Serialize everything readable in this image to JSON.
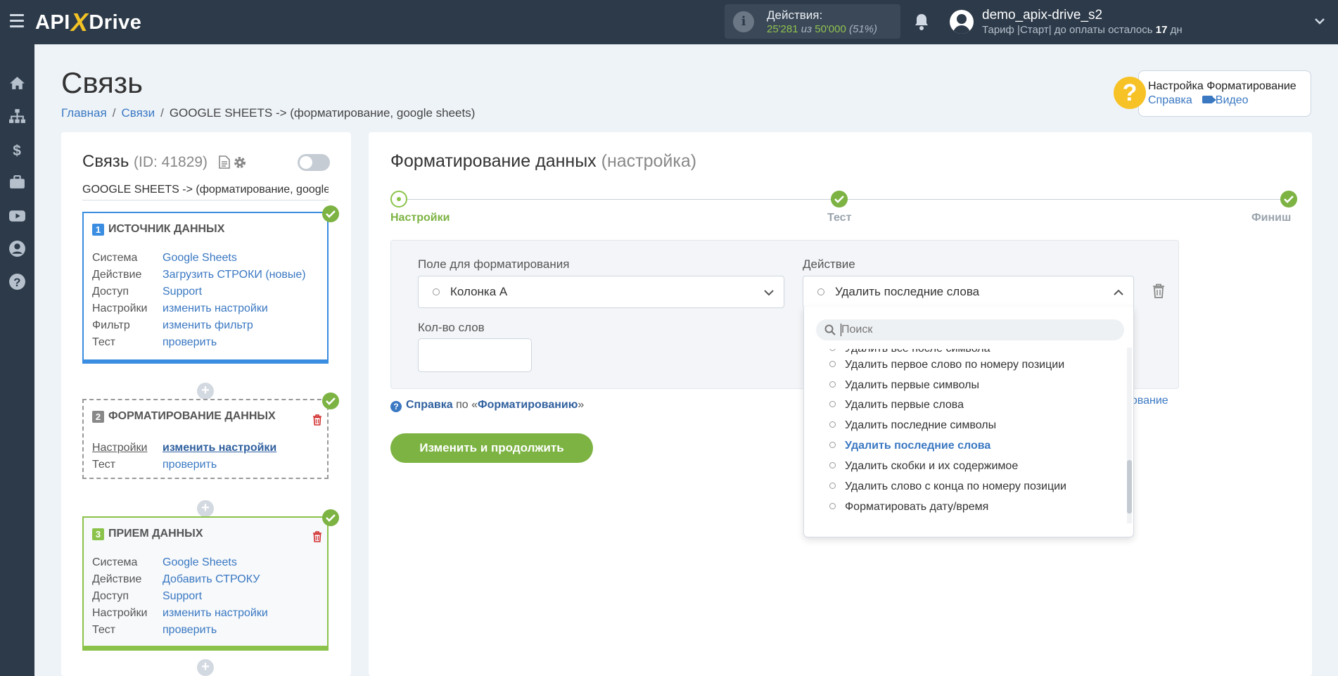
{
  "topbar": {
    "logo_left": "API",
    "logo_x": "X",
    "logo_right": "Drive",
    "actions_label": "Действия:",
    "actions_used": "25'281",
    "actions_of": "из",
    "actions_total": "50'000",
    "actions_percent": "(51%)",
    "user_name": "demo_apix-drive_s2",
    "plan_text": "Тариф |Старт| до оплаты осталось",
    "plan_days": "17",
    "plan_days_unit": "дн"
  },
  "page": {
    "title": "Связь",
    "breadcrumb": [
      "Главная",
      "Связи",
      "GOOGLE SHEETS -> (форматирование, google sheets)"
    ]
  },
  "help": {
    "title": "Настройка Форматирование",
    "link_help": "Справка",
    "link_video": "Видео"
  },
  "connection": {
    "title": "Связь",
    "id_text": "(ID: 41829)",
    "name": "GOOGLE SHEETS -> (форматирование, google sheets)",
    "enabled": false
  },
  "steps": {
    "source": {
      "num": "1",
      "title": "ИСТОЧНИК ДАННЫХ",
      "rows": [
        {
          "k": "Система",
          "v": "Google Sheets"
        },
        {
          "k": "Действие",
          "v": "Загрузить СТРОКИ (новые)"
        },
        {
          "k": "Доступ",
          "v": "Support"
        },
        {
          "k": "Настройки",
          "v": "изменить настройки"
        },
        {
          "k": "Фильтр",
          "v": "изменить фильтр"
        },
        {
          "k": "Тест",
          "v": "проверить"
        }
      ]
    },
    "format": {
      "num": "2",
      "title": "ФОРМАТИРОВАНИЕ ДАННЫХ",
      "rows": [
        {
          "k": "Настройки",
          "v": "изменить настройки"
        },
        {
          "k": "Тест",
          "v": "проверить"
        }
      ]
    },
    "target": {
      "num": "3",
      "title": "ПРИЕМ ДАННЫХ",
      "rows": [
        {
          "k": "Система",
          "v": "Google Sheets"
        },
        {
          "k": "Действие",
          "v": "Добавить СТРОКУ"
        },
        {
          "k": "Доступ",
          "v": "Support"
        },
        {
          "k": "Настройки",
          "v": "изменить настройки"
        },
        {
          "k": "Тест",
          "v": "проверить"
        }
      ]
    },
    "plus": "+"
  },
  "main": {
    "title": "Форматирование данных",
    "title_suffix": "(настройка)",
    "progress": [
      "Настройки",
      "Тест",
      "Финиш"
    ],
    "field_label": "Поле для форматирования",
    "field_value": "Колонка A",
    "action_label": "Действие",
    "action_value": "Удалить последние слова",
    "count_label": "Кол-во слов",
    "count_value": "",
    "help_prefix": "Справка",
    "help_mid": "по «",
    "help_link": "Форматированию",
    "help_suffix": "»",
    "partial_link": "рование",
    "submit": "Изменить и продолжить"
  },
  "dropdown": {
    "search_placeholder": "Поиск",
    "options": [
      "Удалить все после символа",
      "Удалить первое слово по номеру позиции",
      "Удалить первые символы",
      "Удалить первые слова",
      "Удалить последние символы",
      "Удалить последние слова",
      "Удалить скобки и их содержимое",
      "Удалить слово с конца по номеру позиции",
      "Форматировать дату/время"
    ],
    "selected": "Удалить последние слова"
  },
  "colors": {
    "topbar": "#2d3a49",
    "accent_green": "#7cb342",
    "link_blue": "#3a78c2",
    "source_blue": "#3a8de0",
    "help_yellow": "#f7c226"
  }
}
